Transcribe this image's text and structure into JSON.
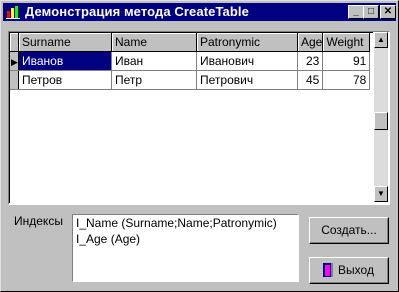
{
  "window": {
    "title": "Демонстрация метода CreateTable"
  },
  "titlebar_buttons": [
    "_",
    "□",
    "✕"
  ],
  "grid": {
    "columns": [
      "Surname",
      "Name",
      "Patronymic",
      "Age",
      "Weight"
    ],
    "rows": [
      [
        "Иванов",
        "Иван",
        "Иванович",
        "23",
        "91"
      ],
      [
        "Петров",
        "Петр",
        "Петрович",
        "45",
        "78"
      ]
    ],
    "scroll_up": "▲",
    "scroll_down": "▼",
    "current_row_marker": "▶"
  },
  "indexes": {
    "label": "Индексы",
    "lines": [
      "I_Name (Surname;Name;Patronymic)",
      "I_Age (Age)"
    ]
  },
  "buttons": {
    "create": "Создать...",
    "exit": "Выход"
  },
  "colors": {
    "title_bg": "#000080",
    "selection": "#000080",
    "face": "#c0c0c0"
  }
}
